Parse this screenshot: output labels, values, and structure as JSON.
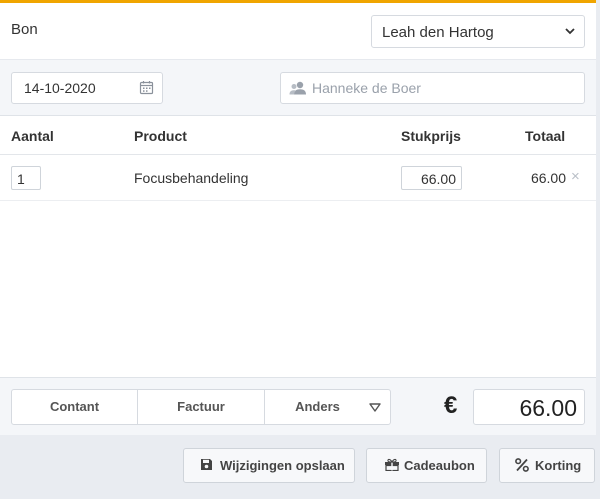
{
  "header": {
    "title": "Bon",
    "employee": "Leah den Hartog"
  },
  "filters": {
    "date": "14-10-2020",
    "client_placeholder": "Hanneke de Boer"
  },
  "table": {
    "columns": {
      "quantity": "Aantal",
      "product": "Product",
      "unit_price": "Stukprijs",
      "total": "Totaal"
    },
    "rows": [
      {
        "quantity": "1",
        "product": "Focusbehandeling",
        "unit_price": "66.00",
        "total": "66.00",
        "remove": "×"
      }
    ]
  },
  "payment": {
    "cash_label": "Contant",
    "invoice_label": "Factuur",
    "other_label": "Anders",
    "currency_symbol": "€",
    "amount": "66.00"
  },
  "actions": {
    "save_label": "Wijzigingen opslaan",
    "giftcard_label": "Cadeaubon",
    "discount_label": "Korting"
  },
  "colors": {
    "accent": "#f0a500",
    "panel_bg": "#ffffff",
    "bar_bg": "#f4f6f9",
    "page_bg": "#e9ecf1"
  },
  "icons": {
    "employee_select": "chevron-down-icon",
    "date": "calendar-icon",
    "client": "users-icon",
    "other_payment": "triangle-down-icon",
    "save": "floppy-disk-icon",
    "giftcard": "gift-icon",
    "discount": "percent-icon"
  }
}
